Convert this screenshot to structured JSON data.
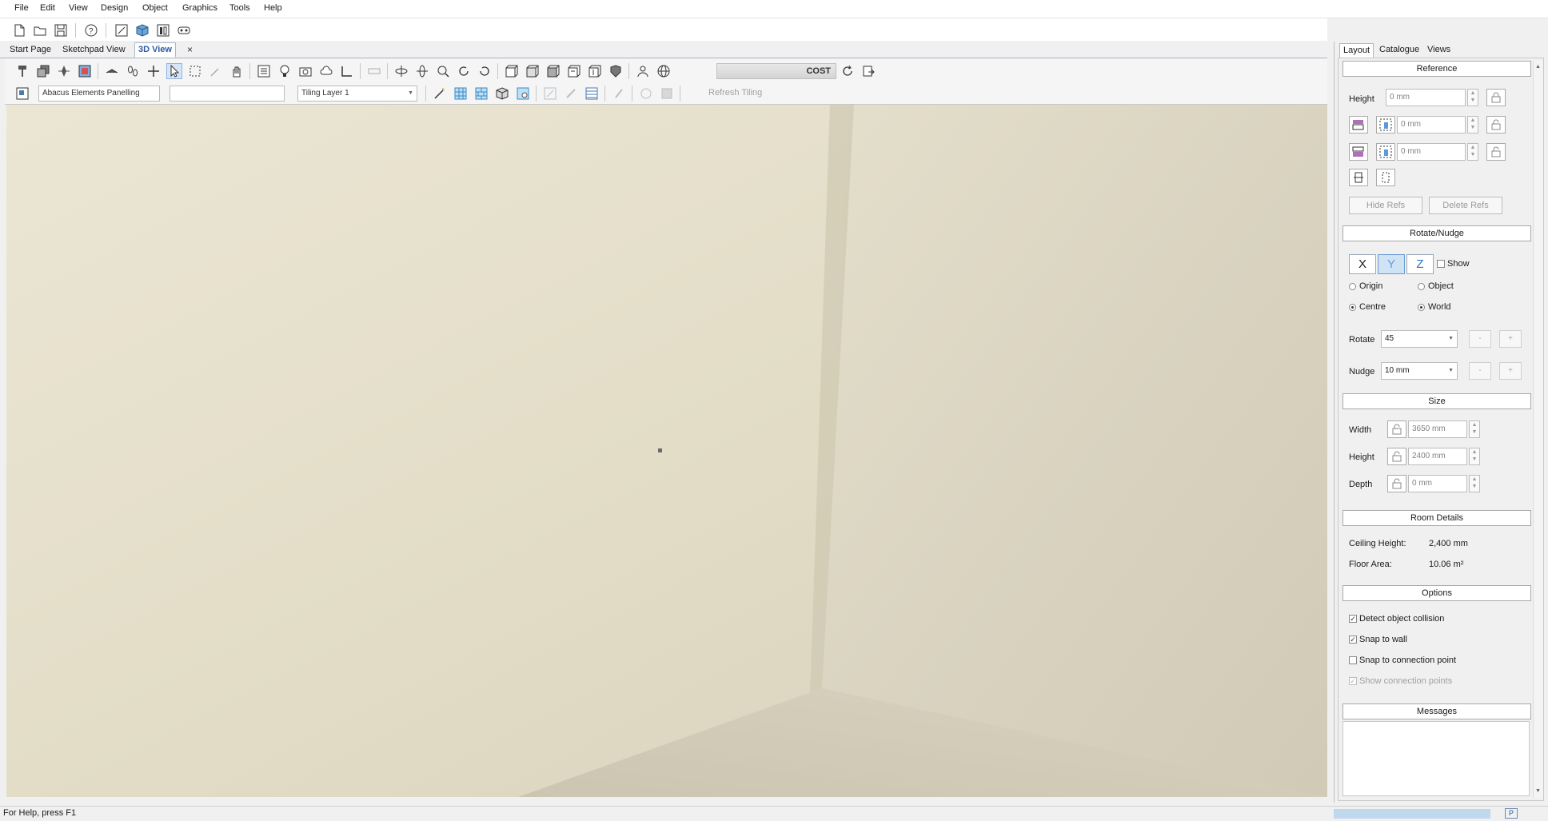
{
  "menu": [
    "File",
    "Edit",
    "View",
    "Design",
    "Object",
    "Graphics",
    "Tools",
    "Help"
  ],
  "quick_toolbar_icons": [
    "new-file-icon",
    "open-folder-icon",
    "save-icon",
    "help-icon",
    "sketchpad-icon",
    "3d-view-icon",
    "elevation-icon",
    "vr-headset-icon"
  ],
  "doc_tabs": [
    {
      "label": "Start Page",
      "active": false
    },
    {
      "label": "Sketchpad View",
      "active": false
    },
    {
      "label": "3D View",
      "active": true
    }
  ],
  "doc_tab_close": "×",
  "toolbar2": {
    "element_select": "Abacus Elements Panelling",
    "blank_field": "",
    "tiling_layer": "Tiling Layer 1",
    "refresh_tiling": "Refresh Tiling"
  },
  "cost_label": "COST",
  "panel": {
    "tabs": [
      "Layout",
      "Catalogue",
      "Views"
    ],
    "reference": {
      "header": "Reference",
      "height_label": "Height",
      "height_value": "0 mm",
      "offset1_value": "0 mm",
      "offset2_value": "0 mm",
      "hide_refs": "Hide Refs",
      "delete_refs": "Delete Refs"
    },
    "rotate_nudge": {
      "header": "Rotate/Nudge",
      "axes": [
        "X",
        "Y",
        "Z"
      ],
      "selected_axis": "Y",
      "show_label": "Show",
      "origin_label": "Origin",
      "object_label": "Object",
      "centre_label": "Centre",
      "world_label": "World",
      "rotate_label": "Rotate",
      "rotate_value": "45",
      "nudge_label": "Nudge",
      "nudge_value": "10 mm",
      "minus": "-",
      "plus": "+"
    },
    "size": {
      "header": "Size",
      "width_label": "Width",
      "width_value": "3650 mm",
      "height_label": "Height",
      "height_value": "2400 mm",
      "depth_label": "Depth",
      "depth_value": "0 mm"
    },
    "room_details": {
      "header": "Room Details",
      "ceiling_label": "Ceiling Height:",
      "ceiling_value": "2,400 mm",
      "floor_label": "Floor Area:",
      "floor_value": "10.06 m²"
    },
    "options": {
      "header": "Options",
      "detect_collision": "Detect object collision",
      "snap_to_wall": "Snap to wall",
      "snap_to_connection": "Snap to connection point",
      "show_connection": "Show connection points",
      "detect_collision_checked": true,
      "snap_to_wall_checked": true,
      "snap_to_connection_checked": false,
      "show_connection_checked": true
    },
    "messages": {
      "header": "Messages"
    }
  },
  "status": {
    "help_text": "For Help, press F1",
    "indicator": "P"
  },
  "colors": {
    "accent": "#2a5aa5",
    "wall_left": "#e3dcc7",
    "wall_right": "#d8d2bf",
    "floor": "#cec8b4"
  }
}
